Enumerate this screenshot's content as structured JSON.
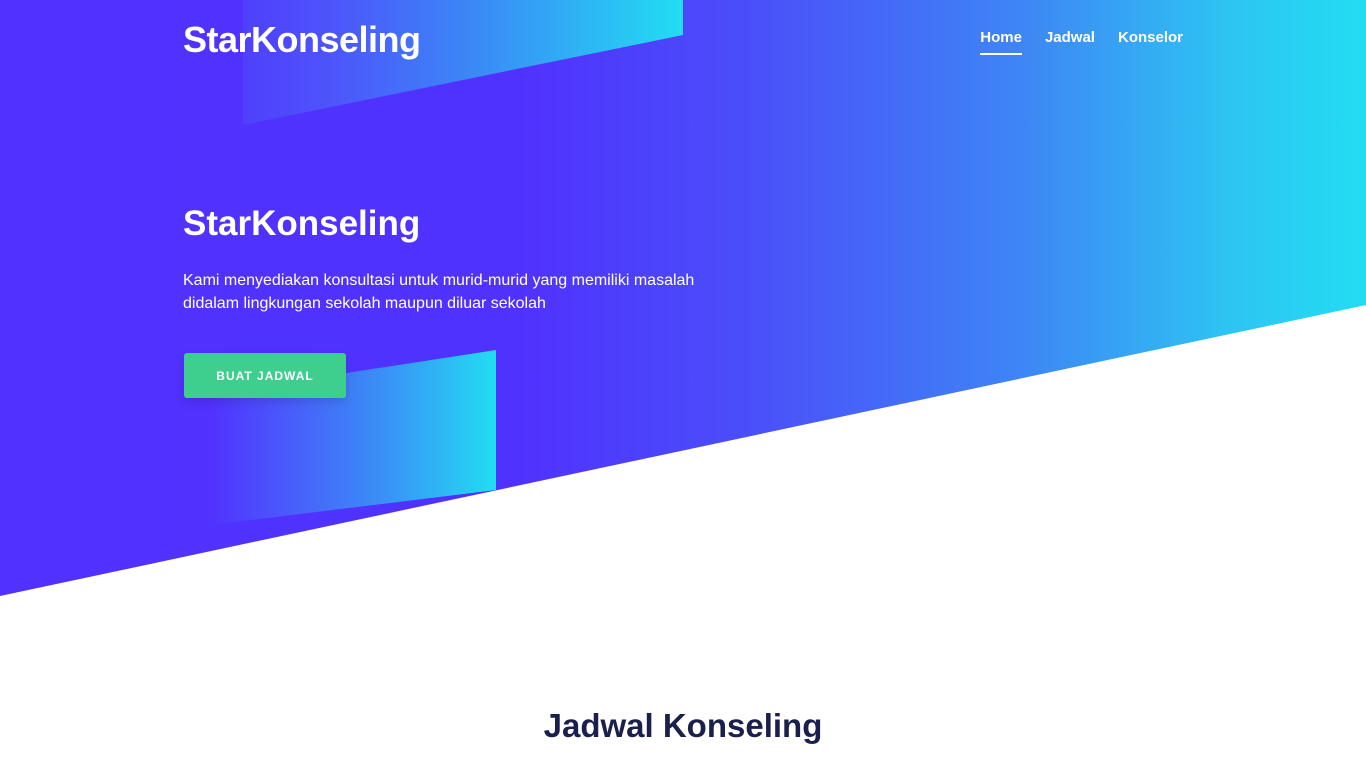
{
  "brand": {
    "logo_text": "StarKonseling"
  },
  "nav": {
    "items": [
      {
        "label": "Home",
        "active": true
      },
      {
        "label": "Jadwal",
        "active": false
      },
      {
        "label": "Konselor",
        "active": false
      }
    ]
  },
  "hero": {
    "title": "StarKonseling",
    "description": "Kami menyediakan konsultasi untuk murid-murid yang memiliki masalah didalam lingkungan sekolah maupun diluar sekolah",
    "cta_label": "BUAT JADWAL"
  },
  "schedule_section": {
    "title": "Jadwal Konseling"
  },
  "colors": {
    "gradient_start": "#5131ff",
    "gradient_end": "#22ddf2",
    "cta_button": "#3ecf8e",
    "section_title": "#1a1f4b"
  }
}
